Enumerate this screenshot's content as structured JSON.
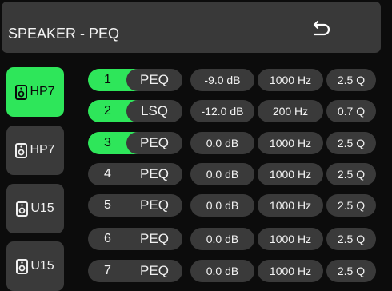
{
  "header": {
    "title": "SPEAKER - PEQ",
    "back_icon": "return-arrow-icon"
  },
  "sidebar": {
    "items": [
      {
        "label": "HP7",
        "active": true,
        "icon": "speaker-icon"
      },
      {
        "label": "HP7",
        "active": false,
        "icon": "speaker-icon"
      },
      {
        "label": "U15",
        "active": false,
        "icon": "speaker-icon"
      },
      {
        "label": "U15",
        "active": false,
        "icon": "speaker-icon"
      }
    ]
  },
  "bands": [
    {
      "num": "1",
      "type": "PEQ",
      "gain": "-9.0 dB",
      "freq": "1000 Hz",
      "q": "2.5 Q",
      "active": true
    },
    {
      "num": "2",
      "type": "LSQ",
      "gain": "-12.0 dB",
      "freq": "200 Hz",
      "q": "0.7 Q",
      "active": true
    },
    {
      "num": "3",
      "type": "PEQ",
      "gain": "0.0 dB",
      "freq": "1000 Hz",
      "q": "2.5 Q",
      "active": true
    },
    {
      "num": "4",
      "type": "PEQ",
      "gain": "0.0 dB",
      "freq": "1000 Hz",
      "q": "2.5 Q",
      "active": false
    },
    {
      "num": "5",
      "type": "PEQ",
      "gain": "0.0 dB",
      "freq": "1000 Hz",
      "q": "2.5 Q",
      "active": false
    },
    {
      "num": "6",
      "type": "PEQ",
      "gain": "0.0 dB",
      "freq": "1000 Hz",
      "q": "2.5 Q",
      "active": false
    },
    {
      "num": "7",
      "type": "PEQ",
      "gain": "0.0 dB",
      "freq": "1000 Hz",
      "q": "2.5 Q",
      "active": false
    }
  ],
  "colors": {
    "accent": "#2ee65a",
    "panel": "#3a3a3a",
    "background": "#0c0c0c"
  }
}
